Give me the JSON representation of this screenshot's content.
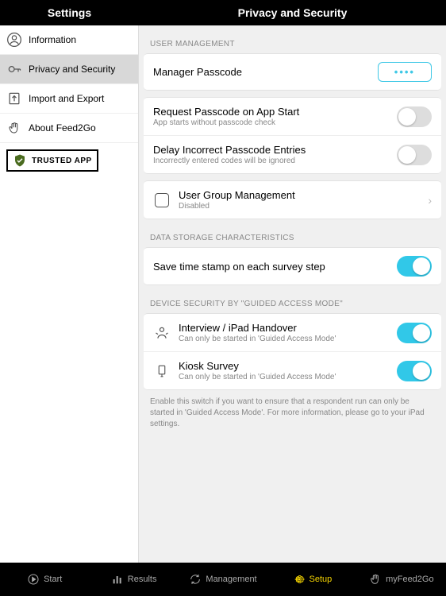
{
  "topbar": {
    "left": "Settings",
    "right": "Privacy and Security"
  },
  "sidebar": {
    "items": [
      {
        "label": "Information",
        "icon": "user-circle"
      },
      {
        "label": "Privacy and Security",
        "icon": "key"
      },
      {
        "label": "Import and Export",
        "icon": "import-export"
      },
      {
        "label": "About Feed2Go",
        "icon": "hand"
      }
    ],
    "trusted_badge": "TRUSTED APP"
  },
  "sections": {
    "user_mgmt_header": "USER MANAGEMENT",
    "manager_passcode": {
      "label": "Manager Passcode",
      "value": "••••"
    },
    "request_passcode": {
      "label": "Request Passcode on App Start",
      "subtitle": "App starts without passcode check",
      "on": false
    },
    "delay_incorrect": {
      "label": "Delay Incorrect Passcode Entries",
      "subtitle": "Incorrectly entered codes will be ignored",
      "on": false
    },
    "user_group": {
      "label": "User Group Management",
      "subtitle": "Disabled"
    },
    "data_storage_header": "DATA STORAGE CHARACTERISTICS",
    "save_timestamp": {
      "label": "Save time stamp on each survey step",
      "on": true
    },
    "device_security_header": "DEVICE SECURITY BY \"GUIDED ACCESS MODE\"",
    "interview": {
      "label": "Interview / iPad Handover",
      "subtitle": "Can only be started in 'Guided Access Mode'",
      "on": true
    },
    "kiosk": {
      "label": "Kiosk Survey",
      "subtitle": "Can only be started in 'Guided Access Mode'",
      "on": true
    },
    "help_text": "Enable this switch if you want to ensure that a respondent run can only be started in 'Guided Access Mode'. For more information, please go to your iPad settings."
  },
  "tabs": [
    {
      "label": "Start",
      "icon": "play"
    },
    {
      "label": "Results",
      "icon": "bars"
    },
    {
      "label": "Management",
      "icon": "sync"
    },
    {
      "label": "Setup",
      "icon": "gear",
      "active": true
    },
    {
      "label": "myFeed2Go",
      "icon": "hand"
    }
  ]
}
